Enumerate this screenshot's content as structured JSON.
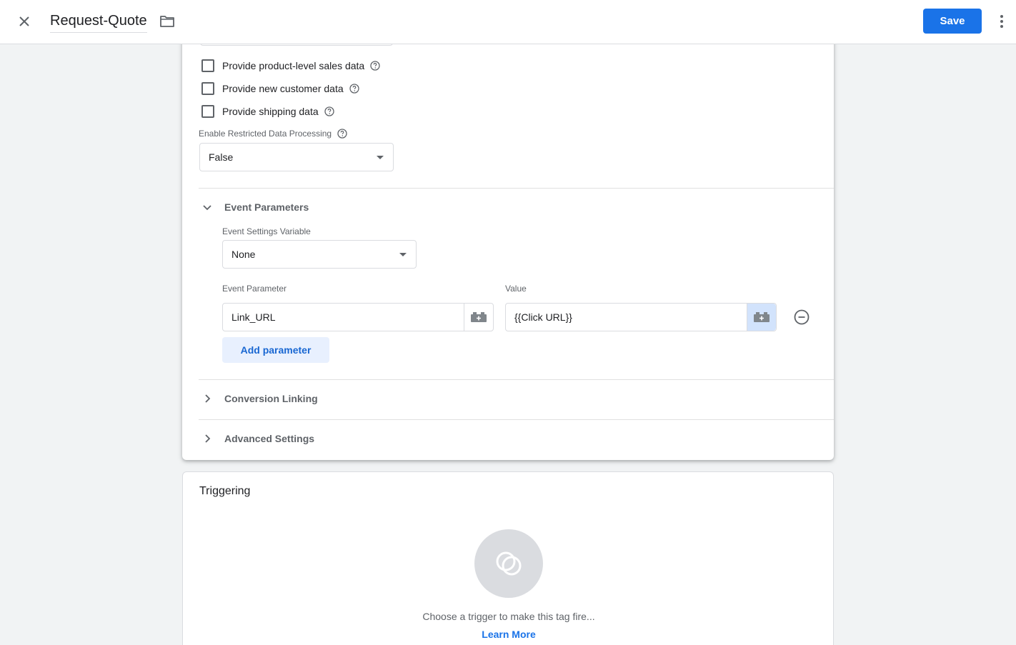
{
  "header": {
    "title": "Request-Quote",
    "save_label": "Save"
  },
  "tag_config": {
    "checkboxes": [
      {
        "label": "Provide product-level sales data",
        "checked": false
      },
      {
        "label": "Provide new customer data",
        "checked": false
      },
      {
        "label": "Provide shipping data",
        "checked": false
      }
    ],
    "restricted_data": {
      "label": "Enable Restricted Data Processing",
      "value": "False"
    },
    "event_parameters": {
      "title": "Event Parameters",
      "expanded": true,
      "settings_variable_label": "Event Settings Variable",
      "settings_variable_value": "None",
      "param_col_label": "Event Parameter",
      "value_col_label": "Value",
      "rows": [
        {
          "parameter": "Link_URL",
          "value": "{{Click URL}}"
        }
      ],
      "add_label": "Add parameter"
    },
    "conversion_linking": {
      "title": "Conversion Linking",
      "expanded": false
    },
    "advanced_settings": {
      "title": "Advanced Settings",
      "expanded": false
    }
  },
  "triggering": {
    "title": "Triggering",
    "hint": "Choose a trigger to make this tag fire...",
    "learn_more": "Learn More"
  },
  "colors": {
    "accent": "#1a73e8",
    "secondary_button_bg": "#e8f0fe",
    "background": "#f1f3f4"
  },
  "icons": [
    "close-icon",
    "folder-icon",
    "more-vert-icon",
    "help-icon",
    "dropdown-arrow-icon",
    "chevron-down-icon",
    "chevron-right-icon",
    "variable-icon",
    "remove-circle-icon",
    "trigger-icon"
  ]
}
